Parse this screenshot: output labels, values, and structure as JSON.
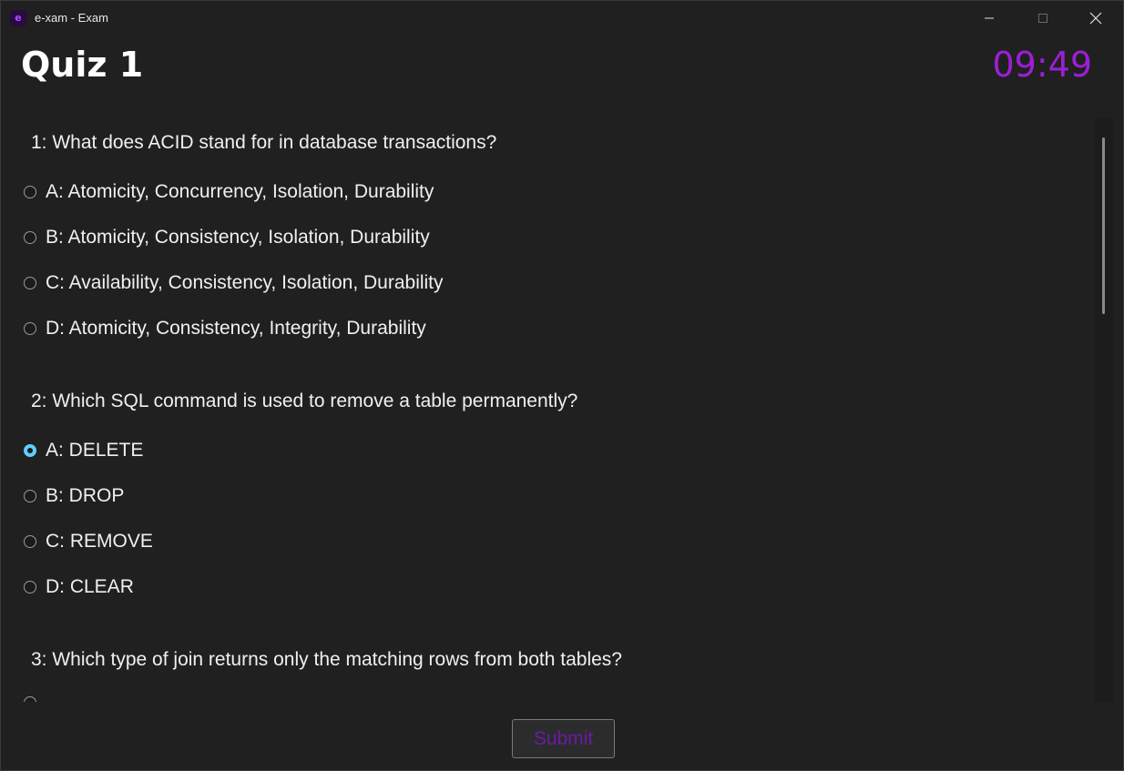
{
  "window": {
    "title": "e-xam - Exam",
    "icon": "e-xam-logo-icon",
    "app_icon_glyph": "e"
  },
  "header": {
    "title": "Quiz 1",
    "timer": "09:49",
    "timer_color": "#9b1fd6"
  },
  "questions": [
    {
      "text": "1: What does ACID stand for in database transactions?",
      "options": [
        {
          "label": "A: Atomicity, Concurrency, Isolation, Durability",
          "selected": false
        },
        {
          "label": "B: Atomicity, Consistency, Isolation, Durability",
          "selected": false
        },
        {
          "label": "C: Availability, Consistency, Isolation, Durability",
          "selected": false
        },
        {
          "label": "D: Atomicity, Consistency, Integrity, Durability",
          "selected": false
        }
      ]
    },
    {
      "text": "2: Which SQL command is used to remove a table permanently?",
      "options": [
        {
          "label": "A: DELETE",
          "selected": true
        },
        {
          "label": "B: DROP",
          "selected": false
        },
        {
          "label": "C: REMOVE",
          "selected": false
        },
        {
          "label": "D: CLEAR",
          "selected": false
        }
      ]
    },
    {
      "text": "3: Which type of join returns only the matching rows from both tables?",
      "options": []
    }
  ],
  "footer": {
    "submit_label": "Submit"
  },
  "colors": {
    "background": "#202020",
    "radio_selected": "#60cdff",
    "submit_text": "#6a1ba5"
  }
}
